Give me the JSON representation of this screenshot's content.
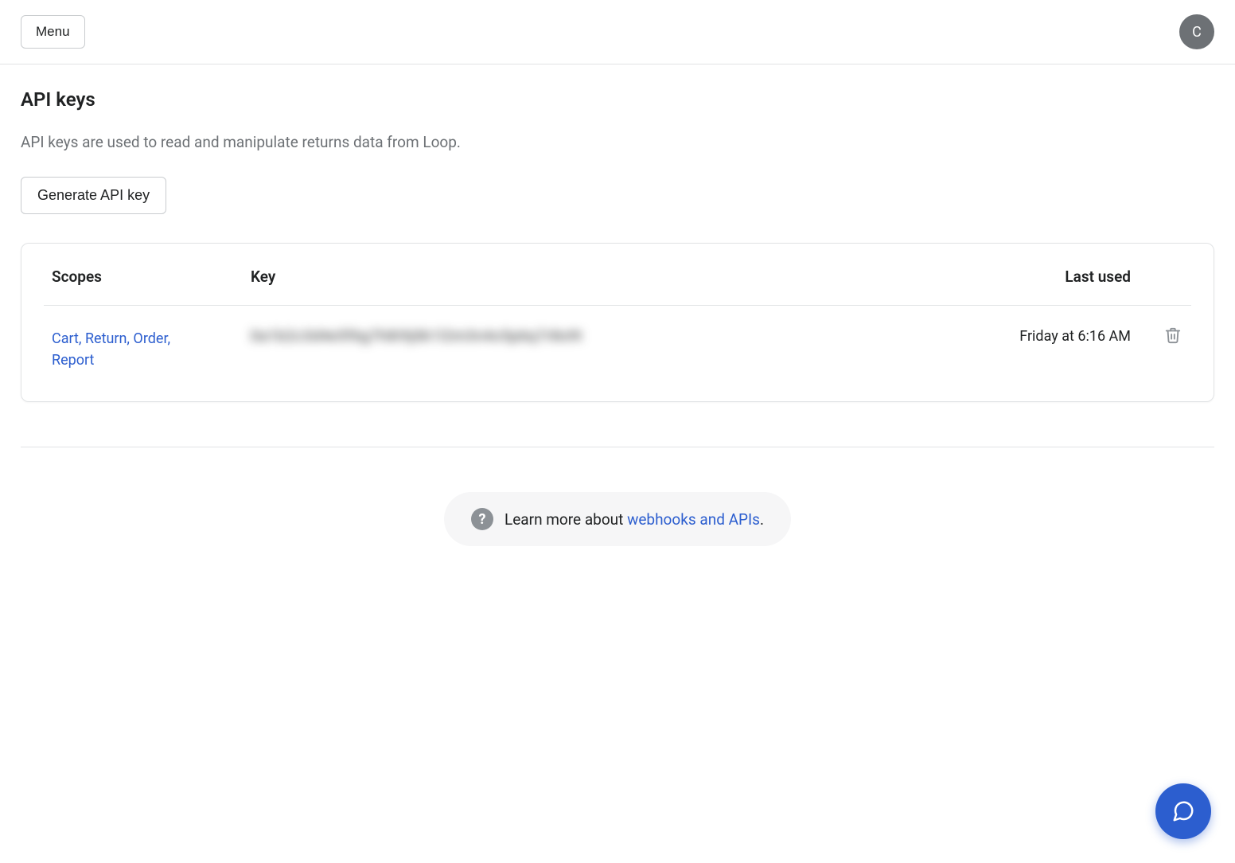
{
  "header": {
    "menu_label": "Menu",
    "avatar_initial": "C"
  },
  "page": {
    "title": "API keys",
    "description": "API keys are used to read and manipulate returns data from Loop.",
    "generate_label": "Generate API key"
  },
  "table": {
    "columns": {
      "scopes": "Scopes",
      "key": "Key",
      "last_used": "Last used"
    },
    "rows": [
      {
        "scopes": "Cart, Return, Order, Report",
        "key": "0a1b2c3d4e5f6g7h8i9j0k1l2m3n4o5p6q7r8s9t",
        "last_used": "Friday at 6:16 AM"
      }
    ]
  },
  "help": {
    "text_prefix": "Learn more about ",
    "link_label": "webhooks and APIs",
    "text_suffix": "."
  }
}
